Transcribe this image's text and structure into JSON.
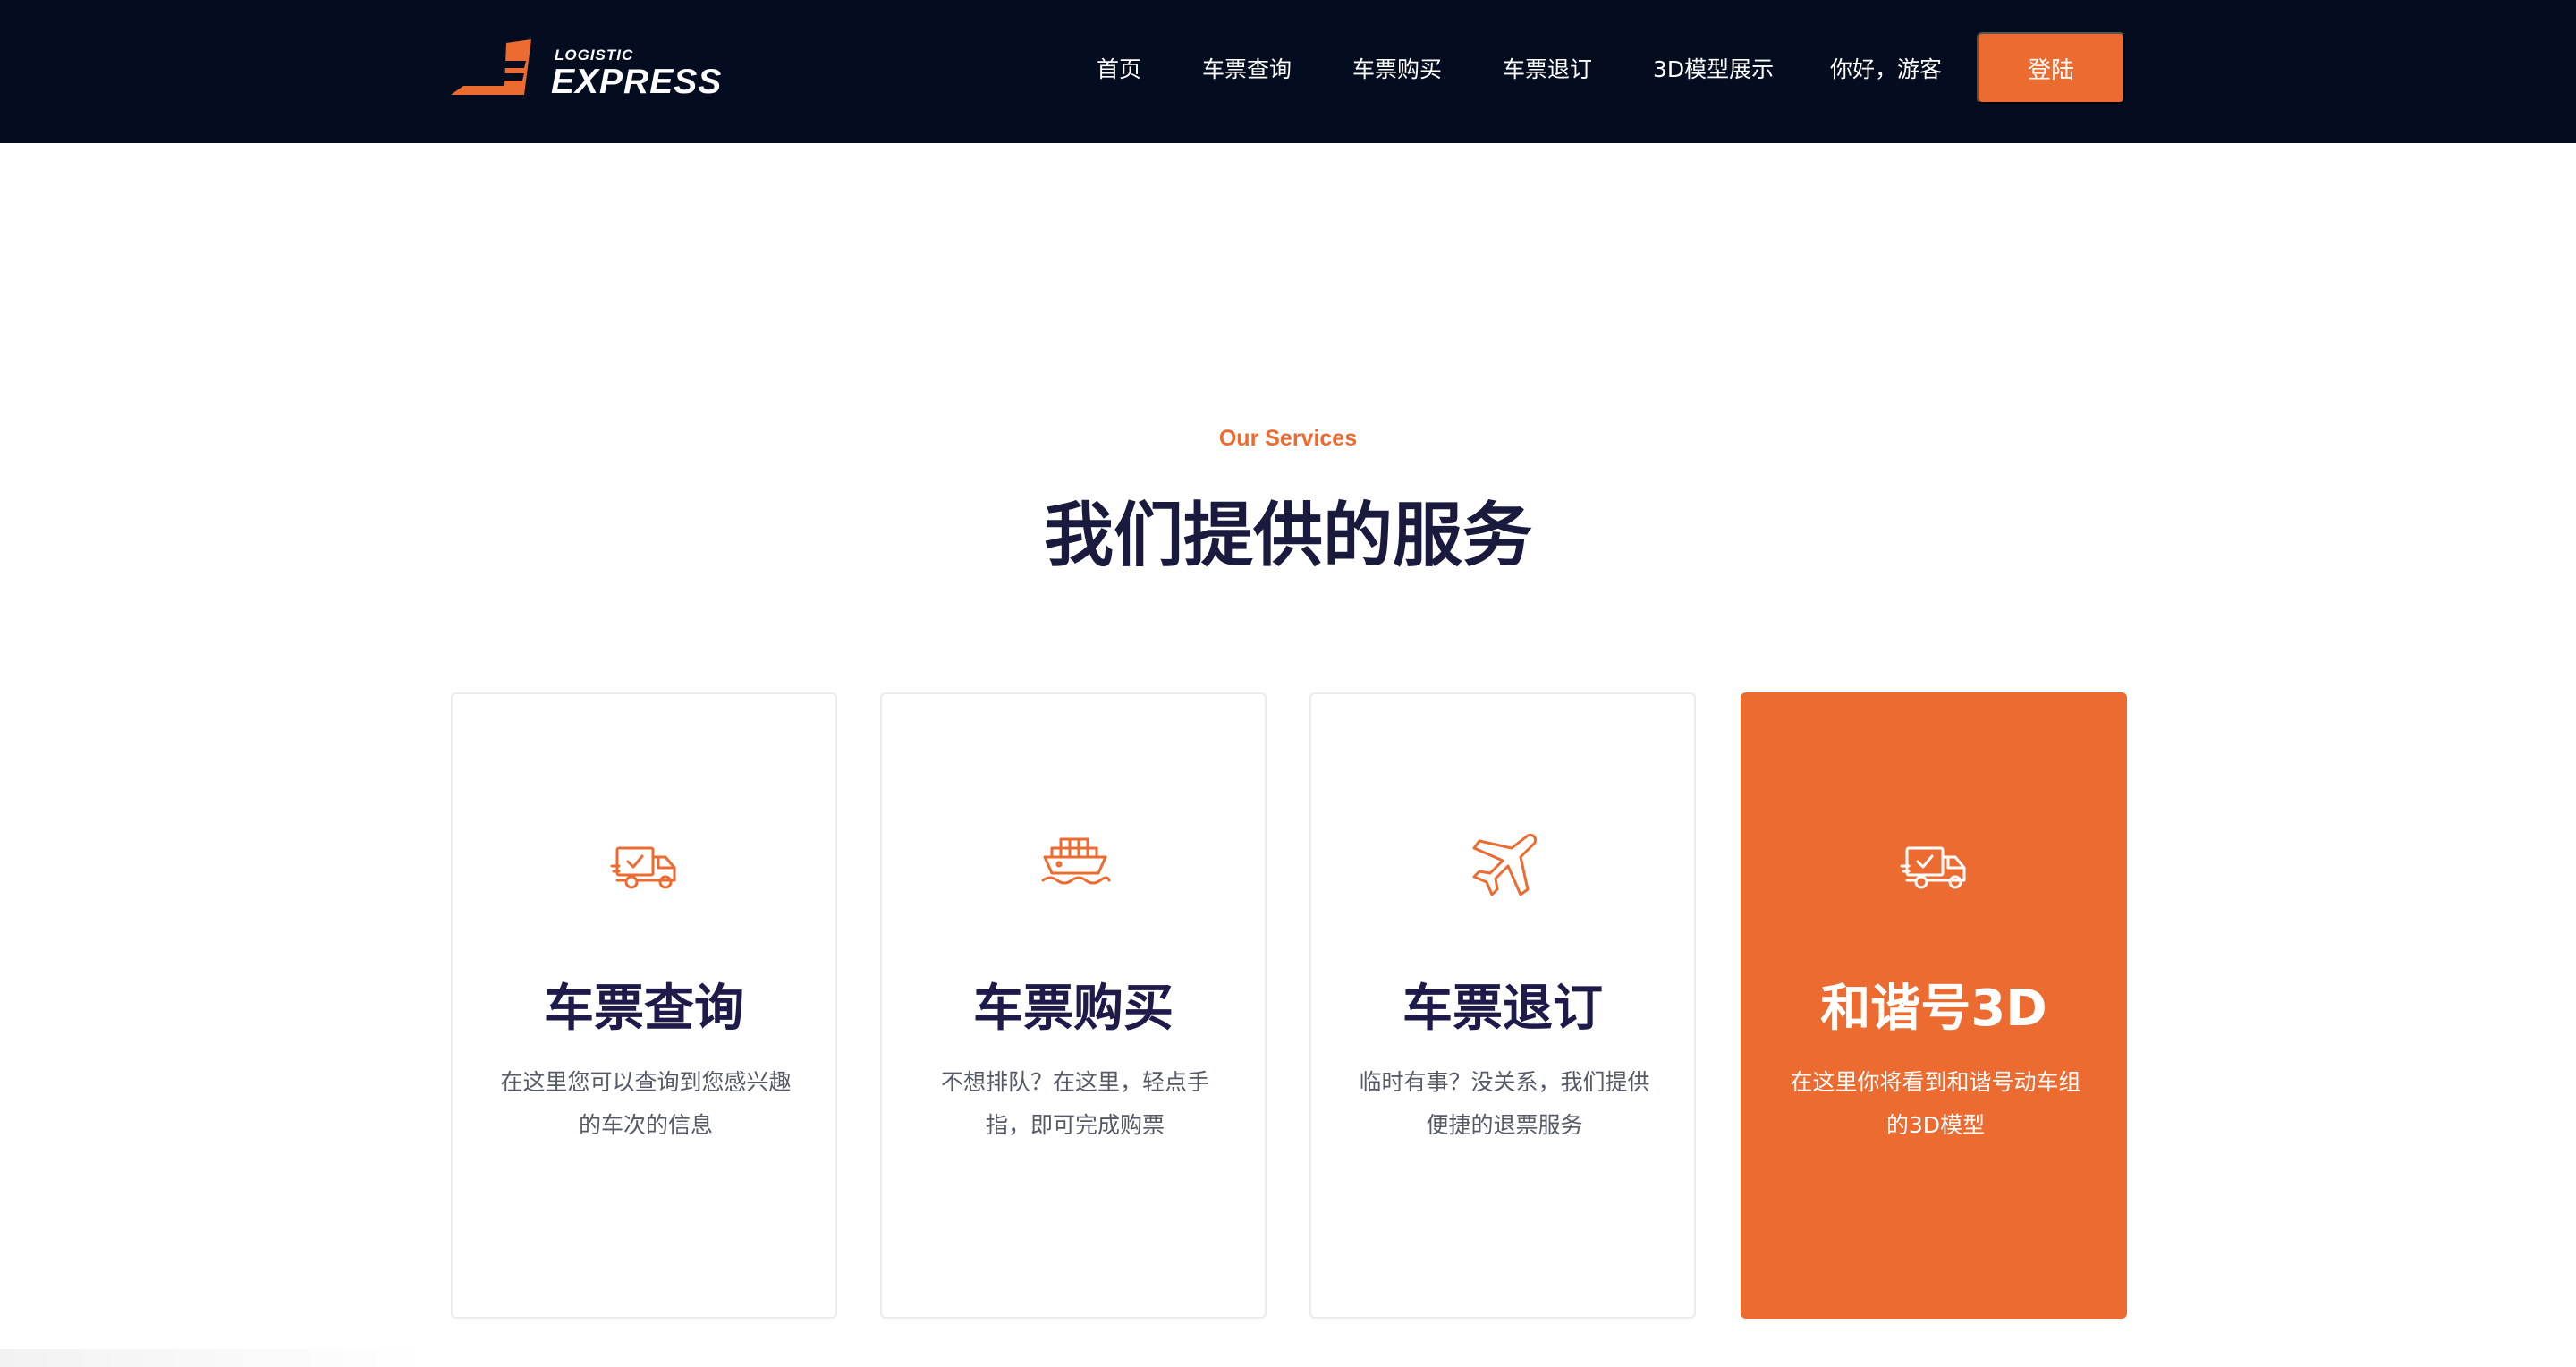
{
  "logo": {
    "small_text": "LOGISTIC",
    "big_text": "EXPRESS"
  },
  "nav": {
    "items": [
      "首页",
      "车票查询",
      "车票购买",
      "车票退订",
      "3D模型展示",
      "你好，游客"
    ],
    "login_label": "登陆"
  },
  "section": {
    "eyebrow": "Our Services",
    "title": "我们提供的服务"
  },
  "cards": [
    {
      "icon": "delivery-truck-icon",
      "title": "车票查询",
      "desc": "在这里您可以查询到您感兴趣的车次的信息"
    },
    {
      "icon": "cargo-ship-icon",
      "title": "车票购买",
      "desc": "不想排队？在这里，轻点手指，即可完成购票"
    },
    {
      "icon": "airplane-icon",
      "title": "车票退订",
      "desc": "临时有事？没关系，我们提供便捷的退票服务"
    },
    {
      "icon": "delivery-truck-icon",
      "title": "和谐号3D",
      "desc": "在这里你将看到和谐号动车组的3D模型"
    }
  ],
  "colors": {
    "accent": "#ec6b31",
    "header_bg": "#040d1f",
    "title": "#1e1a4a"
  }
}
